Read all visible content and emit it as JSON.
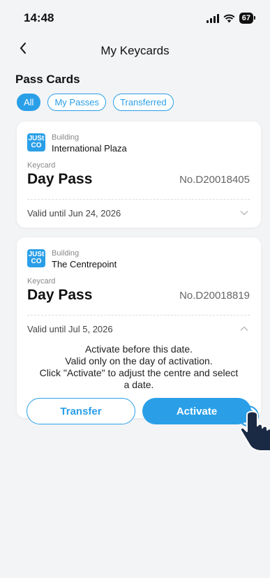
{
  "status": {
    "time": "14:48",
    "battery": "67"
  },
  "nav": {
    "title": "My Keycards",
    "back_icon": "chevron-left-icon"
  },
  "section": {
    "title": "Pass Cards"
  },
  "filters": [
    "All",
    "My Passes",
    "Transferred"
  ],
  "cards": [
    {
      "logo_top": "JUSt",
      "logo_bottom": "CO",
      "building_label": "Building",
      "building_name": "International Plaza",
      "keycard_label": "Keycard",
      "pass_name": "Day Pass",
      "pass_no": "No.D20018405",
      "valid": "Valid until Jun 24, 2026"
    },
    {
      "logo_top": "JUSt",
      "logo_bottom": "CO",
      "building_label": "Building",
      "building_name": "The Centrepoint",
      "keycard_label": "Keycard",
      "pass_name": "Day Pass",
      "pass_no": "No.D20018819",
      "valid": "Valid until Jul 5, 2026",
      "details": [
        "Activate before this date.",
        "Valid only on the day of activation.",
        "Click \"Activate\" to adjust the centre and select",
        "a date."
      ],
      "transfer_label": "Transfer",
      "activate_label": "Activate"
    }
  ],
  "colors": {
    "accent": "#2a9fe8",
    "background": "#f3f4f6"
  }
}
